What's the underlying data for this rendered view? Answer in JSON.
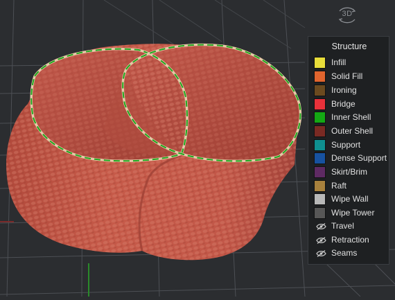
{
  "view_toggle": {
    "label": "3D",
    "icon": "rotate-3d-icon"
  },
  "legend": {
    "title": "Structure",
    "items": [
      {
        "label": "Infill",
        "color": "#e8dd3a"
      },
      {
        "label": "Solid Fill",
        "color": "#e0642e"
      },
      {
        "label": "Ironing",
        "color": "#6b4a1f"
      },
      {
        "label": "Bridge",
        "color": "#e8313a"
      },
      {
        "label": "Inner Shell",
        "color": "#14a814"
      },
      {
        "label": "Outer Shell",
        "color": "#7a2a23"
      },
      {
        "label": "Support",
        "color": "#0f8f8f"
      },
      {
        "label": "Dense Support",
        "color": "#1752a0"
      },
      {
        "label": "Skirt/Brim",
        "color": "#5e2a63"
      },
      {
        "label": "Raft",
        "color": "#a8813d"
      },
      {
        "label": "Wipe Wall",
        "color": "#b8b8b8"
      },
      {
        "label": "Wipe Tower",
        "color": "#575757"
      }
    ],
    "toggles": [
      {
        "label": "Travel",
        "icon": "eye-hidden-icon"
      },
      {
        "label": "Retraction",
        "icon": "eye-hidden-icon"
      },
      {
        "label": "Seams",
        "icon": "eye-hidden-icon"
      }
    ]
  }
}
